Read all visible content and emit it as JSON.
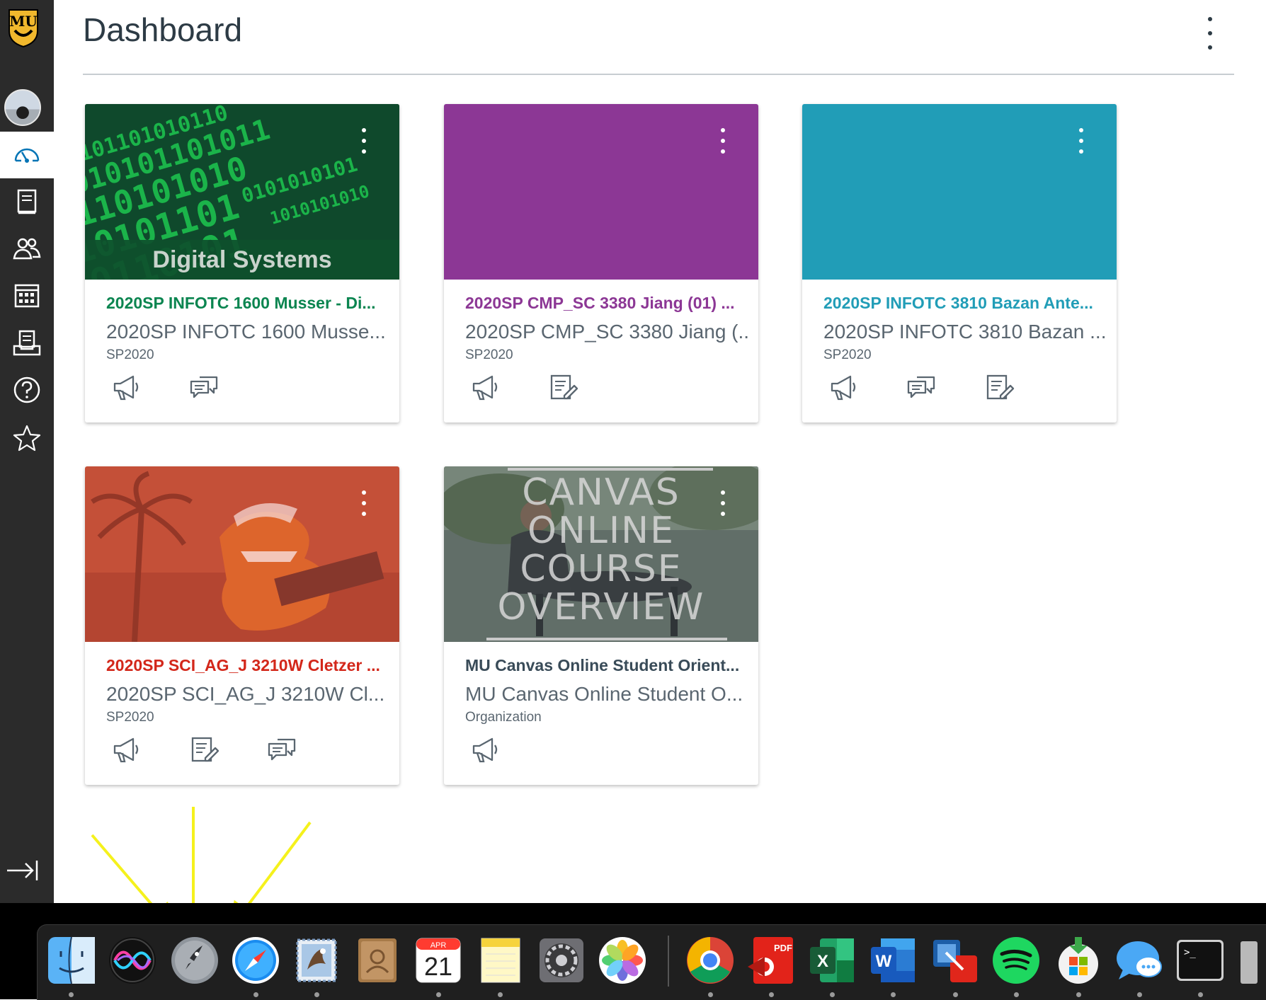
{
  "header": {
    "title": "Dashboard",
    "menu_icon": "vertical-dots-icon"
  },
  "global_nav": {
    "logo": "MU",
    "items": [
      {
        "icon": "account-avatar",
        "label": "Account"
      },
      {
        "icon": "dashboard-icon",
        "label": "Dashboard",
        "active": true
      },
      {
        "icon": "courses-icon",
        "label": "Courses"
      },
      {
        "icon": "groups-icon",
        "label": "Groups"
      },
      {
        "icon": "calendar-icon",
        "label": "Calendar"
      },
      {
        "icon": "inbox-icon",
        "label": "Inbox"
      },
      {
        "icon": "help-icon",
        "label": "Help"
      },
      {
        "icon": "commons-icon",
        "label": "Commons"
      },
      {
        "icon": "collapse-nav-icon",
        "label": "Collapse"
      }
    ]
  },
  "cards": [
    {
      "title": "2020SP INFOTC 1600 Musser - Di...",
      "name": "2020SP INFOTC 1600 Musse...",
      "term": "SP2020",
      "color": "#0b8550",
      "hero_label": "Digital Systems",
      "actions": [
        "announcements-icon",
        "discussions-icon"
      ]
    },
    {
      "title": "2020SP CMP_SC 3380 Jiang (01) ...",
      "name": "2020SP CMP_SC 3380 Jiang (...",
      "term": "SP2020",
      "color": "#8c3795",
      "actions": [
        "announcements-icon",
        "assignments-icon"
      ]
    },
    {
      "title": "2020SP INFOTC 3810 Bazan Ante...",
      "name": "2020SP INFOTC 3810 Bazan ...",
      "term": "SP2020",
      "color": "#219db7",
      "actions": [
        "announcements-icon",
        "discussions-icon",
        "assignments-icon"
      ]
    },
    {
      "title": "2020SP SCI_AG_J 3210W Cletzer ...",
      "name": "2020SP SCI_AG_J 3210W Cl...",
      "term": "SP2020",
      "color": "#d3271a",
      "actions": [
        "announcements-icon",
        "assignments-icon",
        "discussions-icon"
      ]
    },
    {
      "title": "MU Canvas Online Student Orient...",
      "name": "MU Canvas Online Student O...",
      "term": "Organization",
      "color": "#394b58",
      "hero_lines": [
        "CANVAS",
        "ONLINE",
        "COURSE",
        "OVERVIEW"
      ],
      "actions": [
        "announcements-icon"
      ]
    }
  ],
  "dock": {
    "calendar_month": "APR",
    "calendar_day": "21",
    "pdf_label": "PDF",
    "excel_letter": "X",
    "word_letter": "W",
    "terminal_prompt": ">_",
    "apps": [
      "finder-icon",
      "siri-icon",
      "launchpad-icon",
      "safari-icon",
      "mail-icon",
      "contacts-icon",
      "calendar-icon",
      "notes-icon",
      "system-preferences-icon",
      "photos-icon",
      "chrome-icon",
      "pdf-reader-icon",
      "excel-icon",
      "word-icon",
      "vmware-icon",
      "spotify-icon",
      "microsoft-update-icon",
      "messages-icon",
      "terminal-icon"
    ]
  }
}
